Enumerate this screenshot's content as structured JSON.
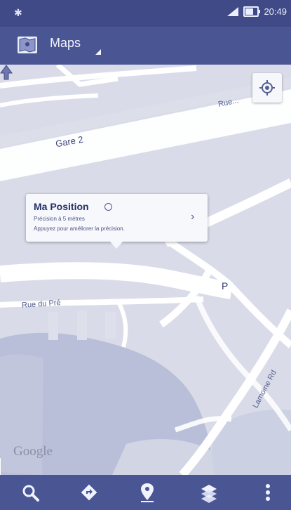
{
  "status_bar": {
    "time": "20:49"
  },
  "app_bar": {
    "title": "Maps"
  },
  "map": {
    "streets": {
      "top_right": "Rue...",
      "left_top": "Gare 2",
      "left_middle": "Rue du Pré",
      "lower_right": "Lamoine Rd"
    },
    "parking_marker": "P",
    "callout": {
      "title": "Ma Position",
      "line1": "Précision à 5 mètres",
      "line2": "Appuyez pour améliorer la précision."
    },
    "attribution": "Google"
  },
  "bottom_bar": {
    "icons": [
      "search-icon",
      "directions-icon",
      "place-icon",
      "layers-icon",
      "menu-icon"
    ]
  }
}
